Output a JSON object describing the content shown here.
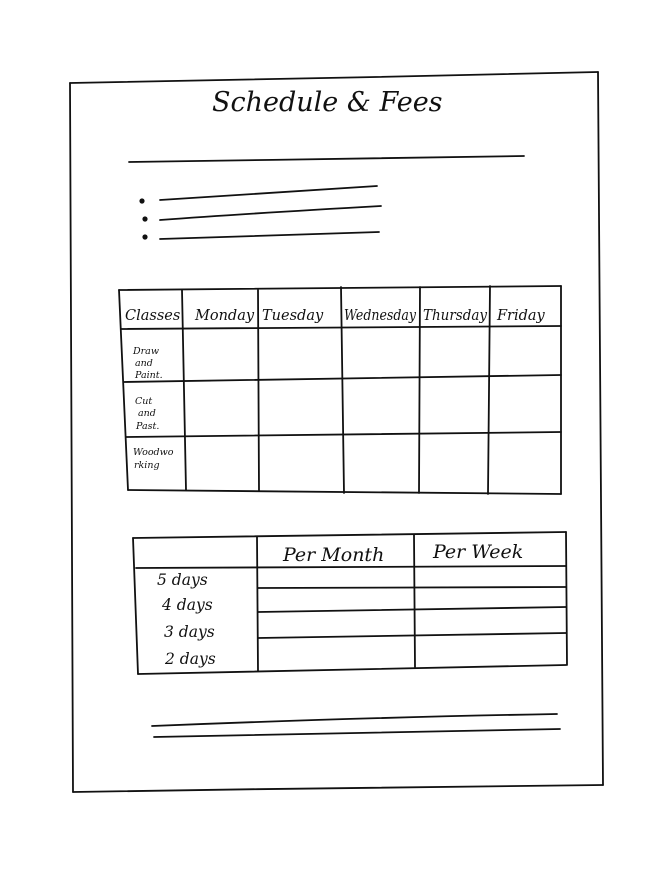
{
  "page": {
    "title": "Schedule & Fees"
  },
  "schedule_table": {
    "corner_header": "Classes",
    "days": [
      "Monday",
      "Tuesday",
      "Wednesday",
      "Thursday",
      "Friday"
    ],
    "classes": [
      [
        "Draw",
        "and",
        "Paint."
      ],
      [
        "Cut",
        "and",
        "Past."
      ],
      [
        "Woodwo",
        "rking"
      ]
    ]
  },
  "fees_table": {
    "columns": [
      "Per Month",
      "Per Week"
    ],
    "rows": [
      "5 days",
      "4 days",
      "3 days",
      "2 days"
    ]
  }
}
